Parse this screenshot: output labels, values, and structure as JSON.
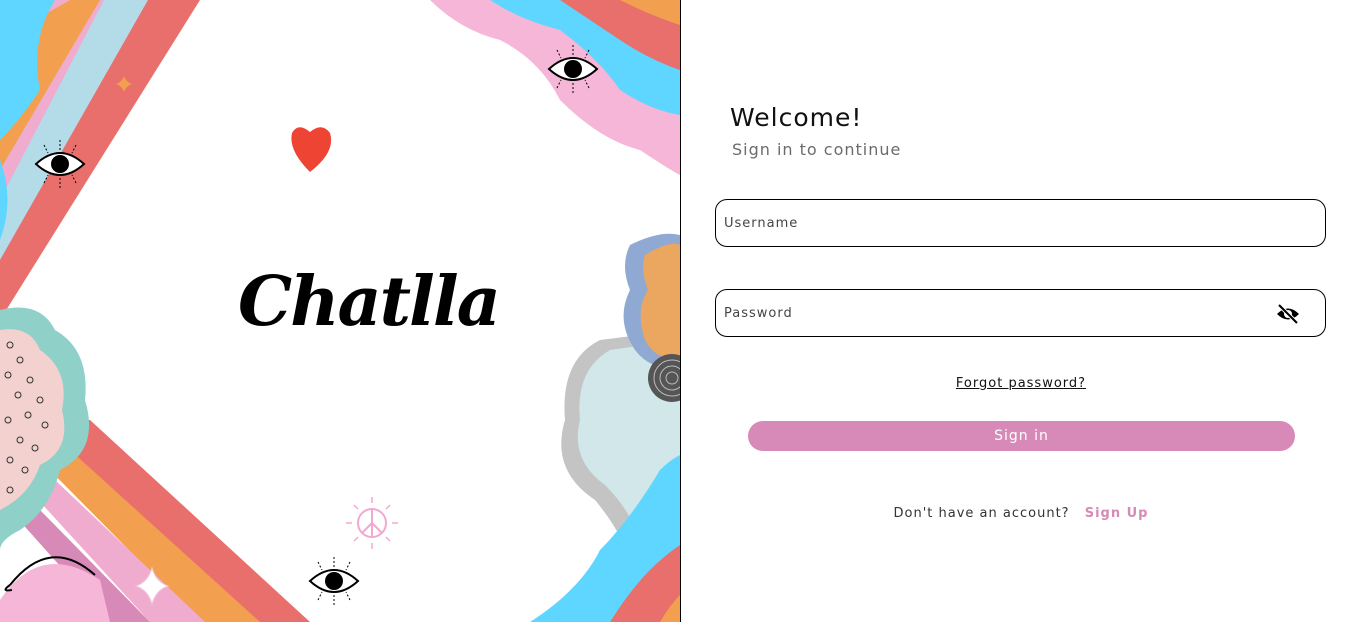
{
  "brand": {
    "logo_text": "Chatlla"
  },
  "form": {
    "title": "Welcome!",
    "subtitle": "Sign in to continue",
    "username_placeholder": "Username",
    "password_placeholder": "Password",
    "forgot_password": "Forgot password?",
    "sign_in": "Sign in",
    "no_account": "Don't have an account?",
    "sign_up": "Sign Up"
  },
  "colors": {
    "accent": "#d78ab7"
  },
  "icons": {
    "password_toggle": "eye-off-icon"
  }
}
